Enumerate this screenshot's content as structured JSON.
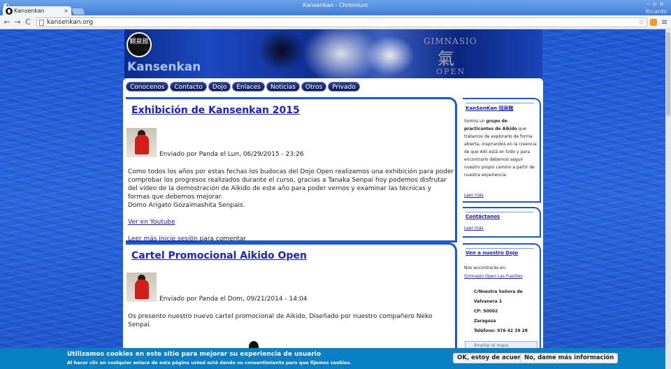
{
  "window": {
    "title": "Kansenkan - Chromium",
    "user": "Ricardo",
    "tab_title": "Kansenkan",
    "tab_close": "×"
  },
  "toolbar": {
    "url": "kansenkan.org",
    "back": "←",
    "forward": "→",
    "reload": "C",
    "star": "☆",
    "menu": "≡"
  },
  "header": {
    "logo_text": "観泉館",
    "site_name": "Kansenkan",
    "gym_text": "GIMNASIO",
    "gym_kanji": "氣",
    "gym_open": "OPEN"
  },
  "menu": [
    "Conocenos",
    "Contacto",
    "Dojo",
    "Enlaces",
    "Noticias",
    "Otros",
    "Privado"
  ],
  "articles": [
    {
      "title": "Exhibición de Kansenkan 2015",
      "meta": "Enviado por Panda el Lun, 06/29/2015 - 23:26",
      "paragraph1": "Como todos los años por estas fechas los budocas del Dojo Open realizamos una exhibición para poder comprobar los progresos realizados durante el curso, gracias a Tanaka Senpai hoy podemos disfrutar del vídeo de la demostración de Aikido de este año para poder vernos y examinar las técnicas y formas que debemos mejorar.",
      "paragraph2": "Domo Arigato Gozaimashita Senpais.",
      "youtube_link": "Ver en Youtube",
      "read_more": "Leer más",
      "login_link": "Inicie sesión",
      "comment_suffix": " para comentar"
    },
    {
      "title": "Cartel Promocional Aikido Open",
      "meta": "Enviado por Panda el Dom, 09/21/2014 - 14:04",
      "paragraph1": "Os presento nuestro nuevo cartel promocional de Aikido, Diseñado por nuestro compañero Neko Senpai."
    }
  ],
  "sidebar": {
    "about": {
      "title": "KanSenKan 冠泉館",
      "text_pre": "Somos un ",
      "text_bold1": "grupo de practicantes de Aikido",
      "text_mid": " que tratamos de explorarlo de forma abierta, inspirandos en la creencia de que Aiki está en todo y para encontrarlo debemos seguir nuestro propio camino a partir de nuestra experiencia.",
      "read_more": "Leer más"
    },
    "contact": {
      "title": "Contáctanos",
      "read_more": "Leer más"
    },
    "visit": {
      "title": "Ven a nuestro Dojo",
      "intro": "Nos encontrarás en:",
      "place_link": "Gimnasio Open Las Fuentes",
      "address1": "C/Nuestra Señora de",
      "address2": "Valvanera 2",
      "cp": "CP: 50002",
      "city": "Zaragoza",
      "phone": "Teléfono: 976 42 39 28",
      "map_label": "Ampliar el mapa"
    }
  },
  "cookie": {
    "title": "Utilizamos cookies en este sitio para mejorar su experiencia de usuario",
    "subtitle": "Al hacer clic en cualquier enlace de esta página usted está dando su consentimiento para que fijemos cookies.",
    "accept": "OK, estoy de acuerdo",
    "info": "No, dame más información"
  },
  "colors": {
    "link": "#1a22c8",
    "frame": "#1a56d8",
    "cookie_bg": "#0a7fc4"
  }
}
